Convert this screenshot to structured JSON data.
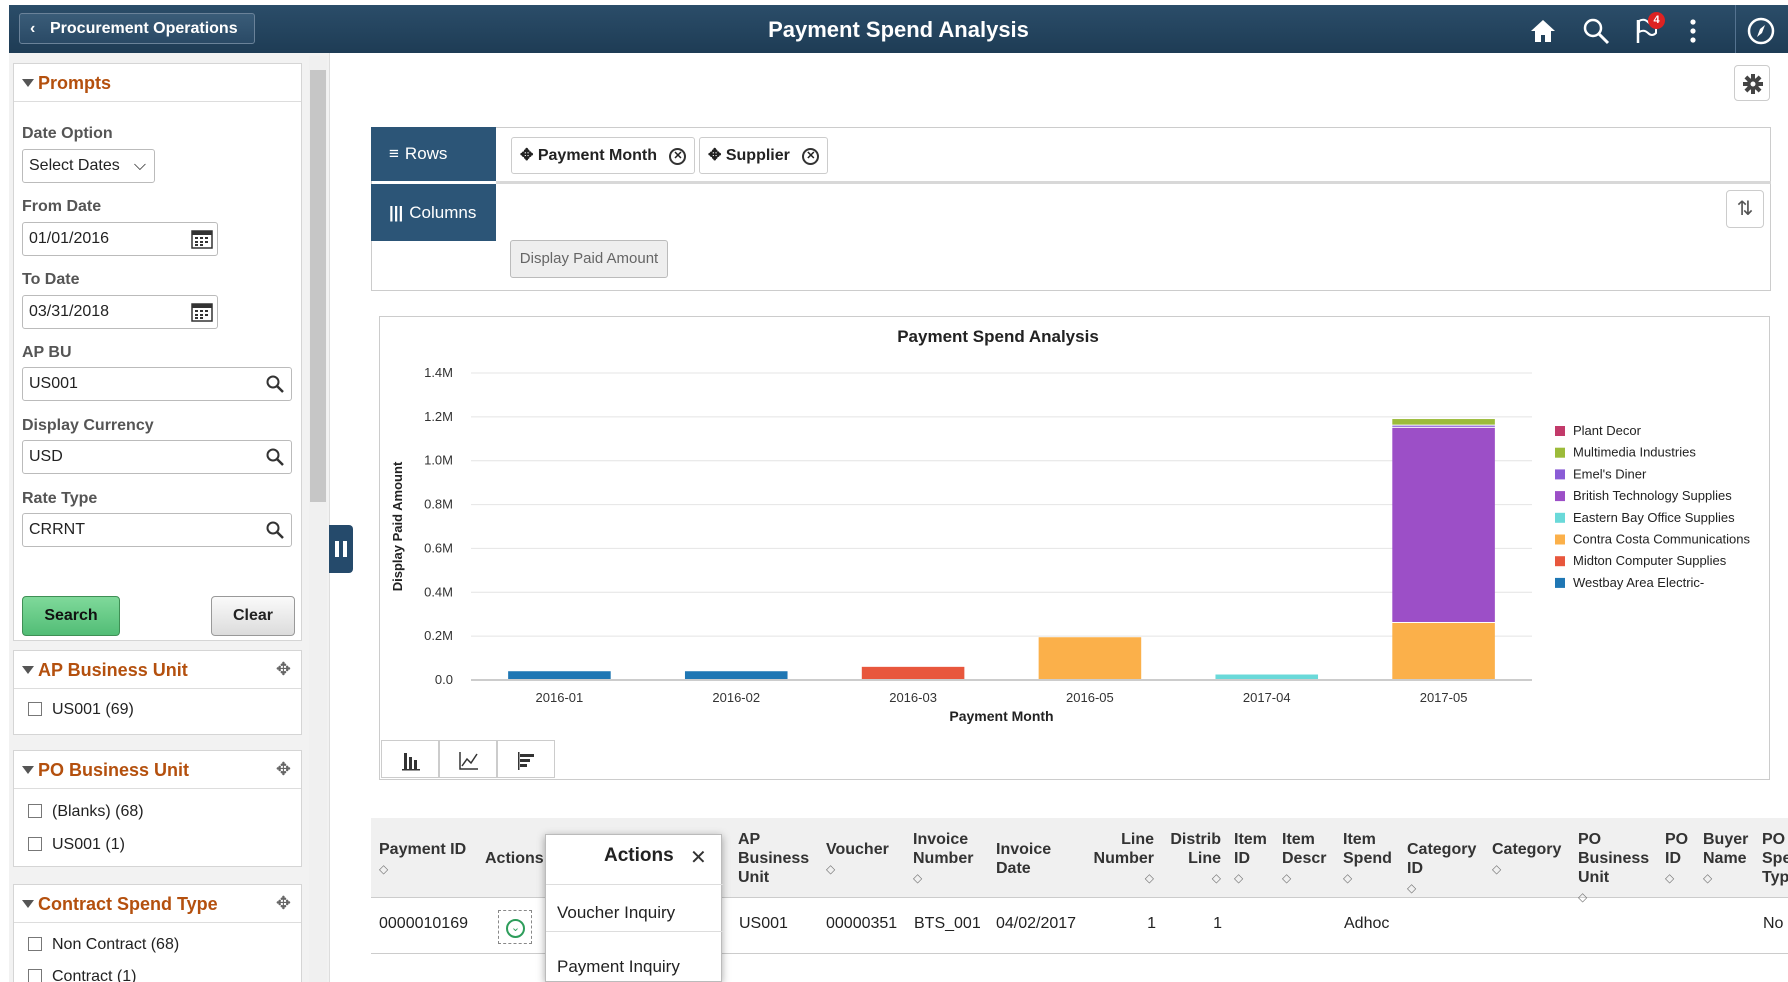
{
  "header": {
    "back_label": "Procurement Operations",
    "title": "Payment Spend Analysis",
    "notification_count": "4"
  },
  "prompts": {
    "title": "Prompts",
    "date_option_label": "Date Option",
    "date_option_value": "Select Dates",
    "from_date_label": "From Date",
    "from_date_value": "01/01/2016",
    "to_date_label": "To Date",
    "to_date_value": "03/31/2018",
    "ap_bu_label": "AP BU",
    "ap_bu_value": "US001",
    "currency_label": "Display Currency",
    "currency_value": "USD",
    "rate_type_label": "Rate Type",
    "rate_type_value": "CRRNT",
    "search_label": "Search",
    "clear_label": "Clear"
  },
  "facets": [
    {
      "title": "AP Business Unit",
      "items": [
        "US001 (69)"
      ]
    },
    {
      "title": "PO Business Unit",
      "items": [
        "(Blanks) (68)",
        "US001 (1)"
      ]
    },
    {
      "title": "Contract Spend Type",
      "items": [
        "Non Contract (68)",
        "Contract (1)"
      ]
    }
  ],
  "pivot": {
    "rows_label": "Rows",
    "columns_label": "Columns",
    "row_fields": [
      "Payment Month",
      "Supplier"
    ],
    "display_button": "Display Paid Amount"
  },
  "chart_data": {
    "type": "bar",
    "stacked": true,
    "title": "Payment Spend Analysis",
    "xlabel": "Payment Month",
    "ylabel": "Display Paid Amount",
    "categories": [
      "2016-01",
      "2016-02",
      "2016-03",
      "2016-05",
      "2017-04",
      "2017-05"
    ],
    "ylim": [
      0,
      1400000
    ],
    "yticks": [
      "0.0",
      "0.2M",
      "0.4M",
      "0.6M",
      "0.8M",
      "1.0M",
      "1.2M",
      "1.4M"
    ],
    "ytick_values": [
      0,
      200000,
      400000,
      600000,
      800000,
      1000000,
      1200000,
      1400000
    ],
    "legend_position": "right",
    "series": [
      {
        "name": "Westbay Area Electric-",
        "color": "#1f77b4",
        "values": [
          40000,
          40000,
          0,
          0,
          0,
          0
        ]
      },
      {
        "name": "Midton Computer Supplies",
        "color": "#e8573d",
        "values": [
          0,
          0,
          60000,
          0,
          0,
          0
        ]
      },
      {
        "name": "Contra Costa Communications",
        "color": "#fbb04a",
        "values": [
          0,
          0,
          0,
          195000,
          0,
          260000
        ]
      },
      {
        "name": "Eastern Bay Office Supplies",
        "color": "#6ad9d9",
        "values": [
          0,
          0,
          0,
          0,
          25000,
          0
        ]
      },
      {
        "name": "British Technology Supplies",
        "color": "#9c4fc7",
        "values": [
          0,
          0,
          0,
          0,
          0,
          890000
        ]
      },
      {
        "name": "Emel's Diner",
        "color": "#8a5cd6",
        "values": [
          0,
          0,
          0,
          0,
          0,
          10000
        ]
      },
      {
        "name": "Multimedia Industries",
        "color": "#9cbb3a",
        "values": [
          0,
          0,
          0,
          0,
          0,
          30000
        ]
      },
      {
        "name": "Plant Decor",
        "color": "#c23a6a",
        "values": [
          0,
          0,
          0,
          0,
          0,
          0
        ]
      }
    ]
  },
  "grid": {
    "headers": [
      {
        "key": "payment_id",
        "label": "Payment ID"
      },
      {
        "key": "actions",
        "label": "Actions"
      },
      {
        "key": "ap_bu",
        "label": "AP Business Unit"
      },
      {
        "key": "voucher",
        "label": "Voucher"
      },
      {
        "key": "invoice_number",
        "label": "Invoice Number"
      },
      {
        "key": "invoice_date",
        "label": "Invoice Date"
      },
      {
        "key": "line_number",
        "label": "Line Number"
      },
      {
        "key": "distrib_line",
        "label": "Distrib Line"
      },
      {
        "key": "item_id",
        "label": "Item ID"
      },
      {
        "key": "item_descr",
        "label": "Item Descr"
      },
      {
        "key": "item_spend",
        "label": "Item Spend"
      },
      {
        "key": "category_id",
        "label": "Category ID"
      },
      {
        "key": "category",
        "label": "Category"
      },
      {
        "key": "po_bu",
        "label": "PO Business Unit"
      },
      {
        "key": "po_id",
        "label": "PO ID"
      },
      {
        "key": "buyer_name",
        "label": "Buyer Name"
      },
      {
        "key": "po_spend_type",
        "label": "PO Spend Type"
      }
    ],
    "rows": [
      {
        "payment_id": "0000010169",
        "ap_bu": "US001",
        "voucher": "00000351",
        "invoice_number": "BTS_001",
        "invoice_date": "04/02/2017",
        "line_number": "1",
        "distrib_line": "1",
        "item_spend": "Adhoc",
        "po_spend_type": "No"
      }
    ]
  },
  "actions_popup": {
    "title": "Actions",
    "items": [
      "Voucher Inquiry",
      "Payment Inquiry"
    ]
  }
}
